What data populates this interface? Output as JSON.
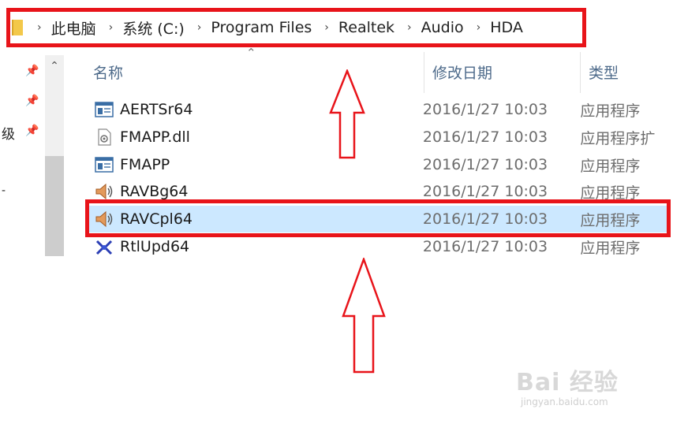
{
  "breadcrumb": {
    "items": [
      "此电脑",
      "系统 (C:)",
      "Program Files",
      "Realtek",
      "Audio",
      "HDA"
    ],
    "separator": "›"
  },
  "nav": {
    "fragments": [
      "级",
      "-"
    ]
  },
  "columns": {
    "name": "名称",
    "date": "修改日期",
    "type": "类型"
  },
  "files": [
    {
      "name": "AERTSr64",
      "date": "2016/1/27 10:03",
      "type": "应用程序",
      "icon": "app-window-icon"
    },
    {
      "name": "FMAPP.dll",
      "date": "2016/1/27 10:03",
      "type": "应用程序扩",
      "icon": "dll-file-icon"
    },
    {
      "name": "FMAPP",
      "date": "2016/1/27 10:03",
      "type": "应用程序",
      "icon": "app-window-icon"
    },
    {
      "name": "RAVBg64",
      "date": "2016/1/27 10:03",
      "type": "应用程序",
      "icon": "speaker-icon"
    },
    {
      "name": "RAVCpl64",
      "date": "2016/1/27 10:03",
      "type": "应用程序",
      "icon": "speaker-icon",
      "selected": true
    },
    {
      "name": "RtlUpd64",
      "date": "2016/1/27 10:03",
      "type": "应用程序",
      "icon": "update-icon"
    }
  ],
  "watermark": {
    "brand": "Bai 经验",
    "url": "jingyan.baidu.com"
  },
  "colors": {
    "annotation_red": "#e8141a",
    "selection": "#cce8ff",
    "header_text": "#4d6a8a"
  }
}
